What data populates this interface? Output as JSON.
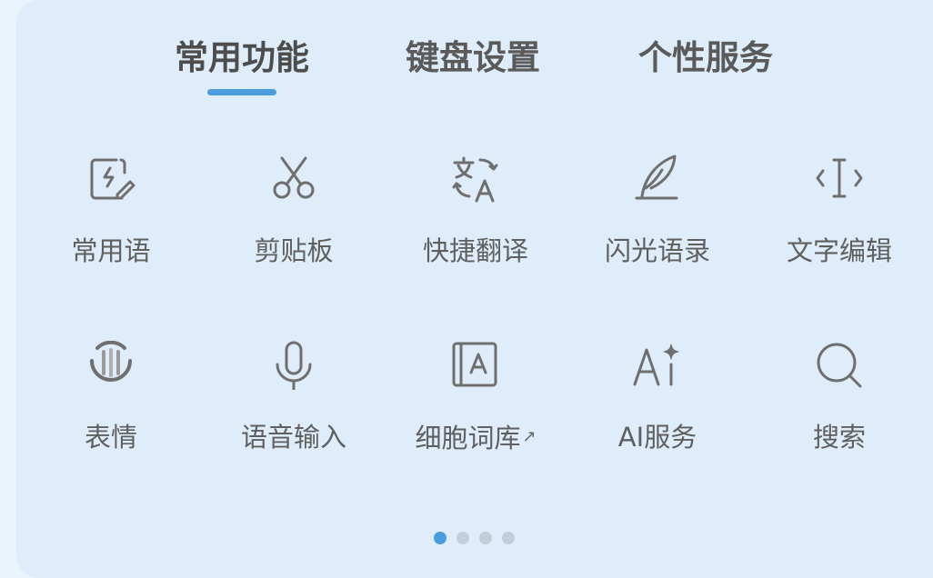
{
  "tabs": [
    {
      "label": "常用功能"
    },
    {
      "label": "键盘设置"
    },
    {
      "label": "个性服务"
    }
  ],
  "items": [
    {
      "label": "常用语",
      "icon": "quick-phrase-icon"
    },
    {
      "label": "剪贴板",
      "icon": "scissors-icon"
    },
    {
      "label": "快捷翻译",
      "icon": "translate-icon"
    },
    {
      "label": "闪光语录",
      "icon": "feather-icon"
    },
    {
      "label": "文字编辑",
      "icon": "text-cursor-icon"
    },
    {
      "label": "表情",
      "icon": "emoji-icon"
    },
    {
      "label": "语音输入",
      "icon": "microphone-icon"
    },
    {
      "label": "细胞词库",
      "icon": "dictionary-icon",
      "ext": "↗"
    },
    {
      "label": "AI服务",
      "icon": "ai-sparkle-icon"
    },
    {
      "label": "搜索",
      "icon": "search-icon"
    }
  ],
  "pagination": {
    "pages": 4,
    "current": 1
  },
  "colors": {
    "accent": "#4a9ee0",
    "panel_bg": "#deedf9",
    "icon": "#6f6f6f",
    "text": "#5f5f5f"
  }
}
